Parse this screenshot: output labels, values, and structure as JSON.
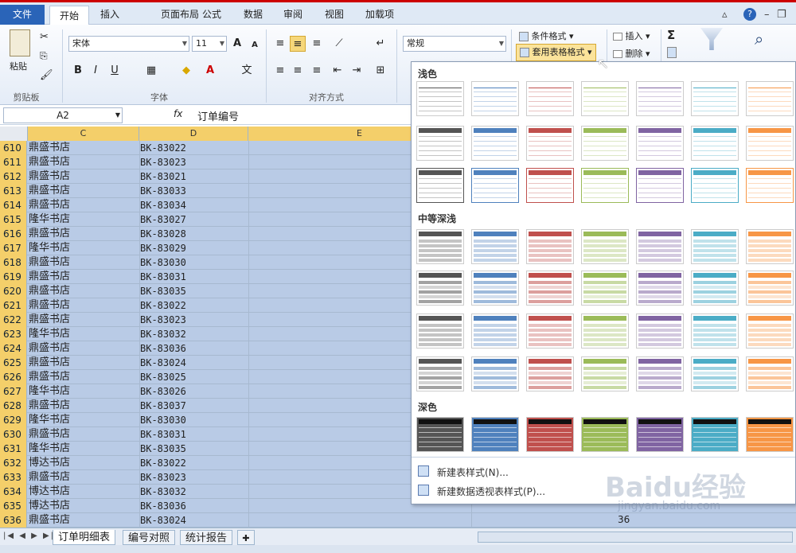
{
  "tabs": [
    "文件",
    "开始",
    "插入",
    "页面布局",
    "公式",
    "数据",
    "审阅",
    "视图",
    "加载项"
  ],
  "ribbon": {
    "paste": "粘贴",
    "clipboard": "剪贴板",
    "font_name": "宋体",
    "font_size": "11",
    "font_group": "字体",
    "align_group": "对齐方式",
    "number_format": "常规",
    "cond_format": "条件格式",
    "table_format": "套用表格格式",
    "insert": "插入",
    "delete": "删除",
    "bold": "B",
    "italic": "I",
    "underline": "U",
    "grow_font": "A",
    "shrink_font": "A",
    "sum_icon": "Σ"
  },
  "formula_bar": {
    "name_box": "A2",
    "fx": "fx",
    "value": "订单编号"
  },
  "columns": [
    {
      "label": "C"
    },
    {
      "label": "D"
    },
    {
      "label": "E"
    }
  ],
  "rows": [
    {
      "n": "610",
      "c": "鼎盛书店",
      "d": "BK-83022"
    },
    {
      "n": "611",
      "c": "鼎盛书店",
      "d": "BK-83023"
    },
    {
      "n": "612",
      "c": "鼎盛书店",
      "d": "BK-83021"
    },
    {
      "n": "613",
      "c": "鼎盛书店",
      "d": "BK-83033"
    },
    {
      "n": "614",
      "c": "鼎盛书店",
      "d": "BK-83034"
    },
    {
      "n": "615",
      "c": "隆华书店",
      "d": "BK-83027"
    },
    {
      "n": "616",
      "c": "鼎盛书店",
      "d": "BK-83028"
    },
    {
      "n": "617",
      "c": "隆华书店",
      "d": "BK-83029"
    },
    {
      "n": "618",
      "c": "鼎盛书店",
      "d": "BK-83030"
    },
    {
      "n": "619",
      "c": "鼎盛书店",
      "d": "BK-83031"
    },
    {
      "n": "620",
      "c": "鼎盛书店",
      "d": "BK-83035"
    },
    {
      "n": "621",
      "c": "鼎盛书店",
      "d": "BK-83022"
    },
    {
      "n": "622",
      "c": "鼎盛书店",
      "d": "BK-83023"
    },
    {
      "n": "623",
      "c": "隆华书店",
      "d": "BK-83032"
    },
    {
      "n": "624",
      "c": "鼎盛书店",
      "d": "BK-83036"
    },
    {
      "n": "625",
      "c": "鼎盛书店",
      "d": "BK-83024"
    },
    {
      "n": "626",
      "c": "鼎盛书店",
      "d": "BK-83025"
    },
    {
      "n": "627",
      "c": "隆华书店",
      "d": "BK-83026"
    },
    {
      "n": "628",
      "c": "鼎盛书店",
      "d": "BK-83037"
    },
    {
      "n": "629",
      "c": "隆华书店",
      "d": "BK-83030"
    },
    {
      "n": "630",
      "c": "鼎盛书店",
      "d": "BK-83031"
    },
    {
      "n": "631",
      "c": "隆华书店",
      "d": "BK-83035"
    },
    {
      "n": "632",
      "c": "博达书店",
      "d": "BK-83022"
    },
    {
      "n": "633",
      "c": "鼎盛书店",
      "d": "BK-83023"
    },
    {
      "n": "634",
      "c": "博达书店",
      "d": "BK-83032"
    },
    {
      "n": "635",
      "c": "博达书店",
      "d": "BK-83036"
    },
    {
      "n": "636",
      "c": "鼎盛书店",
      "d": "BK-83024"
    }
  ],
  "gallery": {
    "light": "浅色",
    "medium": "中等深浅",
    "dark": "深色",
    "new_table_style": "新建表样式(N)...",
    "new_pivot_style": "新建数据透视表样式(P)...",
    "palette": [
      "#555555",
      "#4f81bd",
      "#c0504d",
      "#9bbb59",
      "#8064a2",
      "#4bacc6",
      "#f79646"
    ]
  },
  "sheets": [
    "订单明细表",
    "编号对照",
    "统计报告"
  ],
  "partial_cell": "36",
  "watermark": {
    "line1": "Baidu经验",
    "line2": "jingyan.baidu.com"
  }
}
